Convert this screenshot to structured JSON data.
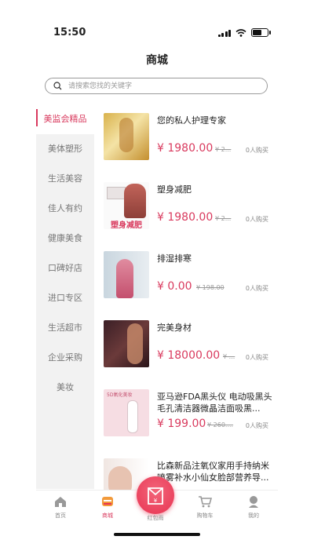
{
  "status": {
    "time": "15:50"
  },
  "nav": {
    "title": "商城"
  },
  "search": {
    "placeholder": "请搜索您找的关键字"
  },
  "sidebar": {
    "items": [
      {
        "label": "美监会精品",
        "active": true
      },
      {
        "label": "美体塑形"
      },
      {
        "label": "生活美容"
      },
      {
        "label": "佳人有约"
      },
      {
        "label": "健康美食"
      },
      {
        "label": "口碑好店"
      },
      {
        "label": "进口专区"
      },
      {
        "label": "生活超市"
      },
      {
        "label": "企业采购"
      },
      {
        "label": "美妆"
      }
    ]
  },
  "products": [
    {
      "title": "您的私人护理专家",
      "price": "¥ 1980.00",
      "old_price": "¥ 2...",
      "sold": "0人购买"
    },
    {
      "title": "塑身减肥",
      "price": "¥ 1980.00",
      "old_price": "¥ 2...",
      "sold": "0人购买"
    },
    {
      "title": "排湿排寒",
      "price": "¥ 0.00",
      "old_price": "¥ 198.00",
      "sold": "0人购买"
    },
    {
      "title": "完美身材",
      "price": "¥ 18000.00",
      "old_price": "¥ ...",
      "sold": "0人购买"
    },
    {
      "title": "亚马逊FDA黑头仪 电动吸黑头毛孔清洁器微晶洁面吸黑...",
      "price": "¥ 199.00",
      "old_price": "¥ 260....",
      "sold": "0人购买"
    },
    {
      "title": "比森新品注氧仪家用手持纳米喷雾补水小仙女脸部营养导..."
    }
  ],
  "thumb_text": {
    "slim": "塑身减肥",
    "device": "5D氧化美妆"
  },
  "tabbar": {
    "home": "首页",
    "mall": "商城",
    "redpacket": "红包雨",
    "cart": "购物车",
    "mine": "我的"
  },
  "colors": {
    "accent": "#d93a5e",
    "sidebar_bg": "#f2f2f2"
  }
}
